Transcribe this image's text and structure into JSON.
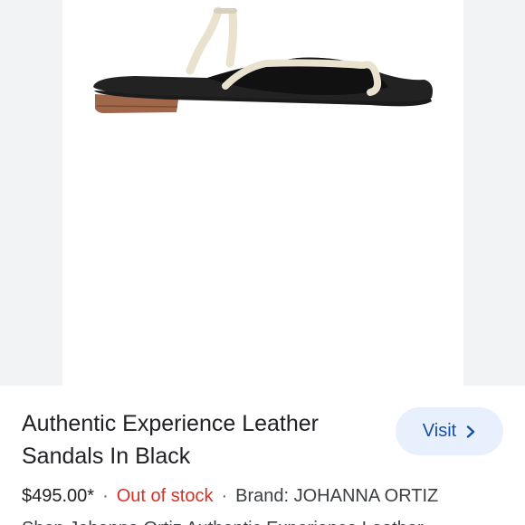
{
  "product": {
    "title": "Authentic Experience Leather Sandals In Black",
    "price": "$495.00*",
    "separator": "·",
    "stock_status": "Out of stock",
    "brand": "Brand: JOHANNA ORTIZ",
    "description_peek": "Shop Johanna Ortiz Authentic Experience Leather"
  },
  "actions": {
    "visit_label": "Visit",
    "visit_icon": "chevron-right-icon"
  },
  "colors": {
    "accent": "#174ea6",
    "button_bg": "#e8f0fe",
    "stock_red": "#d93025",
    "image_gutter": "#f1f3f4"
  }
}
